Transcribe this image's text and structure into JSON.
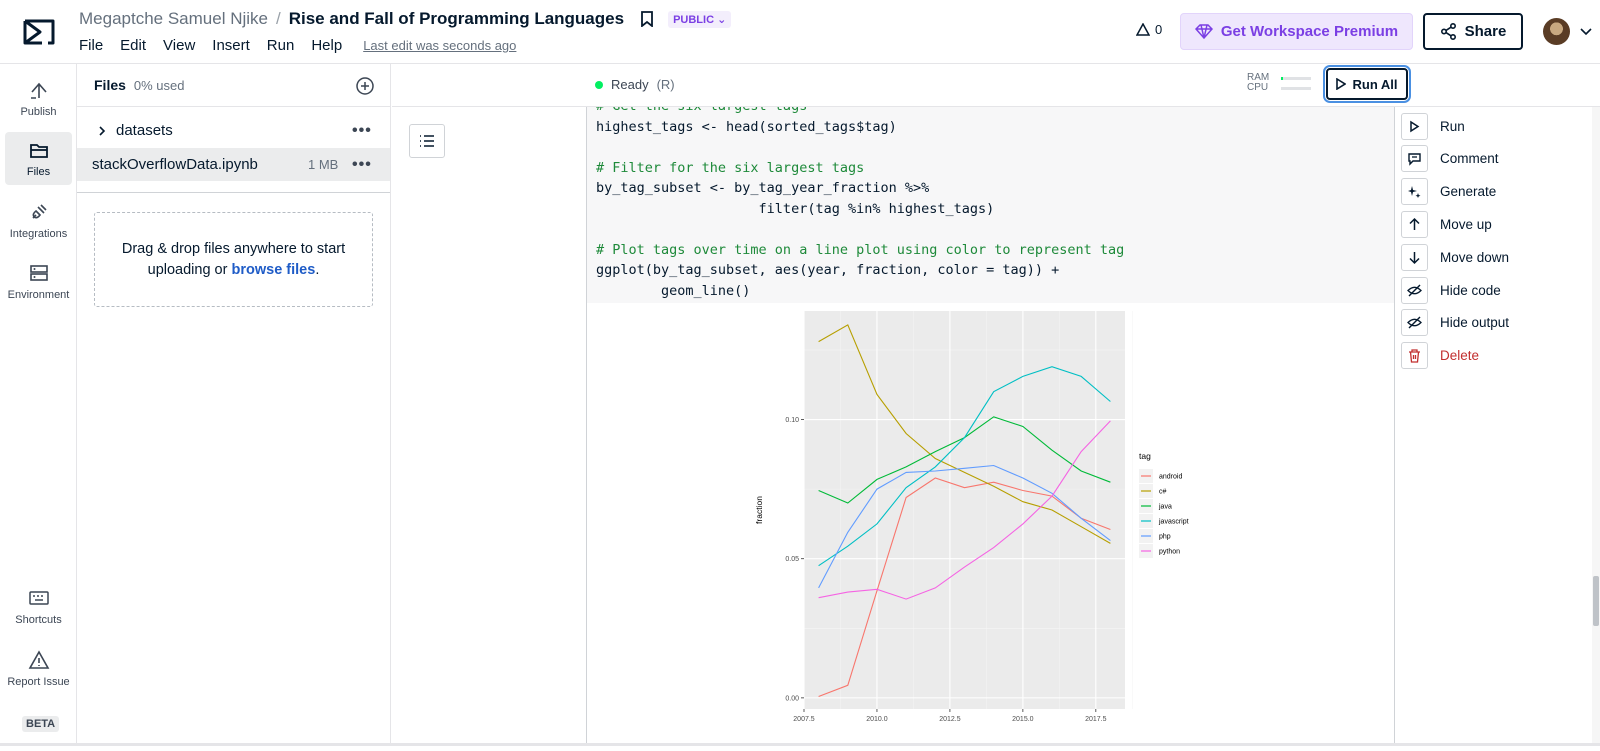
{
  "header": {
    "owner": "Megaptche Samuel Njike",
    "separator": "/",
    "title": "Rise and Fall of Programming Languages",
    "visibility": "PUBLIC",
    "menu": [
      "File",
      "Edit",
      "View",
      "Insert",
      "Run",
      "Help"
    ],
    "last_edit": "Last edit was seconds ago",
    "alerts_count": "0",
    "premium_label": "Get Workspace Premium",
    "share_label": "Share"
  },
  "leftnav": {
    "items": [
      {
        "label": "Publish",
        "icon": "publish-icon"
      },
      {
        "label": "Files",
        "icon": "folder-icon",
        "active": true
      },
      {
        "label": "Integrations",
        "icon": "plug-icon"
      },
      {
        "label": "Environment",
        "icon": "server-icon"
      },
      {
        "label": "Shortcuts",
        "icon": "keyboard-icon"
      },
      {
        "label": "Report Issue",
        "icon": "warning-icon"
      }
    ],
    "beta": "BETA"
  },
  "files": {
    "title": "Files",
    "usage": "0% used",
    "folder": "datasets",
    "file": {
      "name": "stackOverflowData.ipynb",
      "size": "1 MB"
    },
    "drop_text": "Drag & drop files anywhere to start uploading or",
    "drop_link": "browse files",
    "drop_end": "."
  },
  "status": {
    "state": "Ready",
    "kernel": "(R)",
    "ram_label": "RAM",
    "cpu_label": "CPU",
    "ram_used": 0.05,
    "cpu_used": 0.0,
    "run_all": "Run All"
  },
  "code": {
    "lines": [
      {
        "text": "# Get the six largest tags",
        "comment": true
      },
      {
        "text": "highest_tags <- head(sorted_tags$tag)",
        "comment": false
      },
      {
        "text": "",
        "comment": false
      },
      {
        "text": "# Filter for the six largest tags",
        "comment": true
      },
      {
        "text": "by_tag_subset <- by_tag_year_fraction %>%",
        "comment": false
      },
      {
        "text": "                    filter(tag %in% highest_tags)",
        "comment": false
      },
      {
        "text": "",
        "comment": false
      },
      {
        "text": "# Plot tags over time on a line plot using color to represent tag",
        "comment": true
      },
      {
        "text": "ggplot(by_tag_subset, aes(year, fraction, color = tag)) +",
        "comment": false
      },
      {
        "text": "        geom_line()",
        "comment": false
      }
    ]
  },
  "context_menu": [
    {
      "label": "Run",
      "icon": "play-icon"
    },
    {
      "label": "Comment",
      "icon": "comment-icon"
    },
    {
      "label": "Generate",
      "icon": "sparkle-icon"
    },
    {
      "label": "Move up",
      "icon": "arrow-up-icon"
    },
    {
      "label": "Move down",
      "icon": "arrow-down-icon"
    },
    {
      "label": "Hide code",
      "icon": "eye-off-icon"
    },
    {
      "label": "Hide output",
      "icon": "eye-off-icon"
    },
    {
      "label": "Delete",
      "icon": "trash-icon",
      "danger": true
    }
  ],
  "chart_data": {
    "type": "line",
    "xlabel": "",
    "ylabel": "fraction",
    "xlim": [
      2007.5,
      2018.5
    ],
    "ylim": [
      -0.004,
      0.139
    ],
    "xticks": [
      "2007.5",
      "2010.0",
      "2012.5",
      "2015.0",
      "2017.5"
    ],
    "xtick_values": [
      2007.5,
      2010.0,
      2012.5,
      2015.0,
      2017.5
    ],
    "yticks": [
      "0.00",
      "0.05",
      "0.10"
    ],
    "ytick_values": [
      0.0,
      0.05,
      0.1
    ],
    "legend_title": "tag",
    "legend_position": "right",
    "grid": true,
    "background": "#ebebeb",
    "x": [
      2008,
      2009,
      2010,
      2011,
      2012,
      2013,
      2014,
      2015,
      2016,
      2017,
      2018
    ],
    "series": [
      {
        "name": "android",
        "color": "#f8766d",
        "values": [
          0.0005,
          0.0045,
          0.0385,
          0.072,
          0.079,
          0.0755,
          0.0775,
          0.0745,
          0.0725,
          0.0645,
          0.0605
        ]
      },
      {
        "name": "c#",
        "color": "#b79f00",
        "values": [
          0.128,
          0.134,
          0.109,
          0.095,
          0.086,
          0.081,
          0.076,
          0.0705,
          0.0675,
          0.0615,
          0.0555
        ]
      },
      {
        "name": "java",
        "color": "#00ba38",
        "values": [
          0.0745,
          0.07,
          0.0785,
          0.083,
          0.0885,
          0.0935,
          0.101,
          0.0975,
          0.089,
          0.0815,
          0.0775
        ]
      },
      {
        "name": "javascript",
        "color": "#00bfc4",
        "values": [
          0.0475,
          0.0545,
          0.0625,
          0.0755,
          0.083,
          0.0935,
          0.11,
          0.1155,
          0.119,
          0.1155,
          0.1065
        ]
      },
      {
        "name": "php",
        "color": "#619cff",
        "values": [
          0.0395,
          0.0595,
          0.075,
          0.081,
          0.0815,
          0.0825,
          0.0835,
          0.079,
          0.0735,
          0.0645,
          0.0565
        ]
      },
      {
        "name": "python",
        "color": "#f564e3",
        "values": [
          0.036,
          0.038,
          0.039,
          0.0355,
          0.0395,
          0.047,
          0.054,
          0.0625,
          0.0725,
          0.0885,
          0.0995
        ]
      }
    ]
  }
}
